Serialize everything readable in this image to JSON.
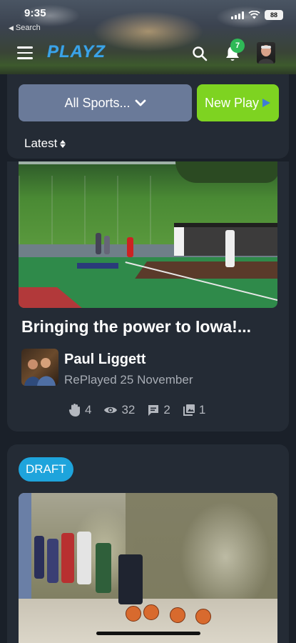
{
  "status_bar": {
    "time": "9:35",
    "back_label": "Search",
    "battery": "88"
  },
  "header": {
    "logo_text": "PLAYZ",
    "notification_count": "7",
    "icons": [
      "menu-icon",
      "search-icon",
      "bell-icon",
      "avatar"
    ]
  },
  "filters": {
    "sport_select": "All Sports...",
    "new_play_label": "New Play",
    "sort_label": "Latest"
  },
  "feed": [
    {
      "title": "Bringing the power to Iowa!...",
      "author": "Paul Liggett",
      "meta": "RePlayed 25 November",
      "stats": {
        "claps": "4",
        "views": "32",
        "comments": "2",
        "media": "1"
      }
    },
    {
      "badge": "DRAFT"
    }
  ],
  "colors": {
    "background": "#1a2029",
    "card": "#242b35",
    "select": "#6a7a99",
    "new_play": "#7ed321",
    "draft_badge": "#1ea4dc",
    "notification_badge": "#2fb957"
  }
}
